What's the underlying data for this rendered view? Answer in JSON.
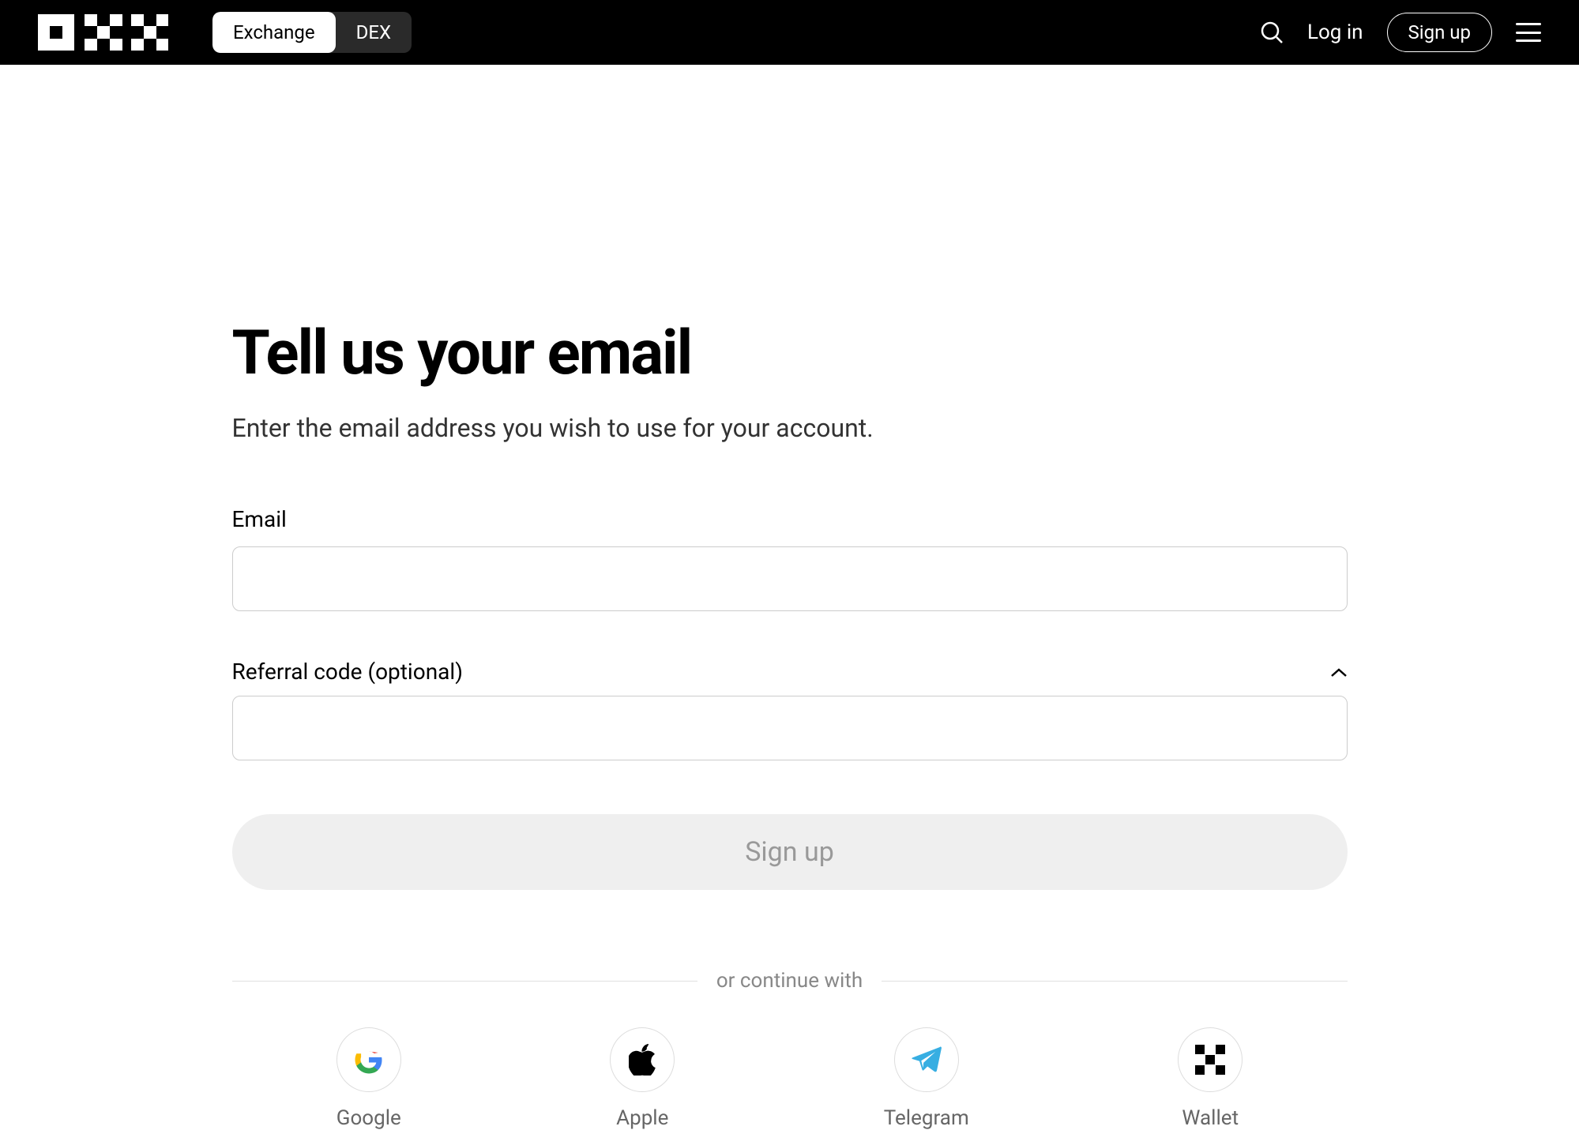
{
  "header": {
    "tabs": {
      "exchange": "Exchange",
      "dex": "DEX"
    },
    "login": "Log in",
    "signup": "Sign up"
  },
  "main": {
    "title": "Tell us your email",
    "subtitle": "Enter the email address you wish to use for your account.",
    "email_label": "Email",
    "email_value": "",
    "referral_label": "Referral code (optional)",
    "referral_value": "",
    "signup_button": "Sign up",
    "divider_text": "or continue with",
    "social": {
      "google": "Google",
      "apple": "Apple",
      "telegram": "Telegram",
      "wallet": "Wallet"
    }
  }
}
